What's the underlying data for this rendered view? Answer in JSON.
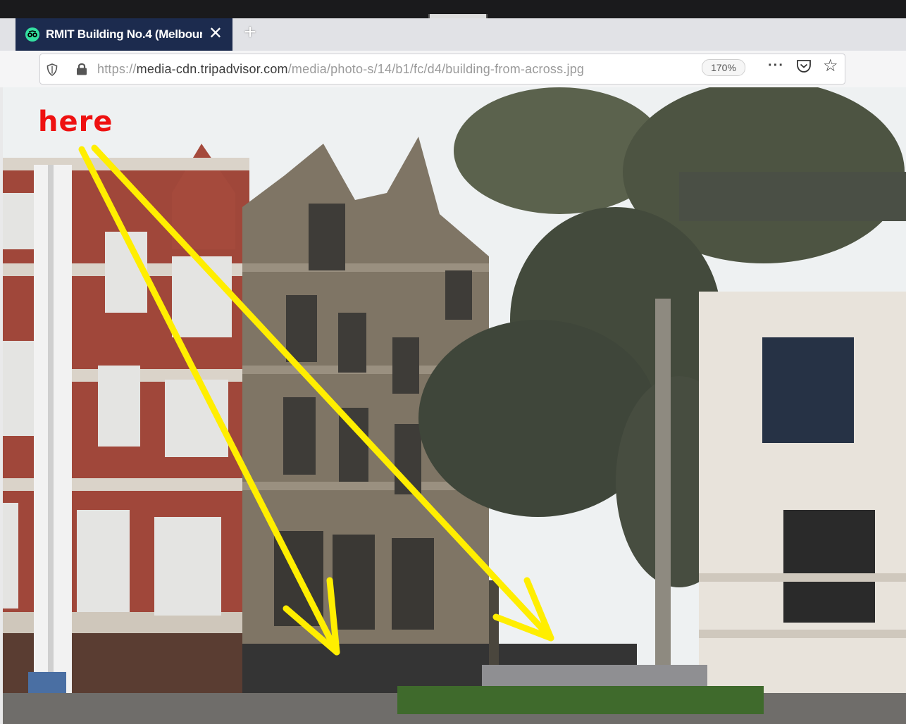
{
  "browser": {
    "tab": {
      "title": "RMIT Building No.4 (Melbourn",
      "favicon": "tripadvisor-owl-icon",
      "close_glyph": "✕"
    },
    "new_tab_glyph": "+",
    "url_scheme": "https://",
    "url_host": "media-cdn.tripadvisor.com",
    "url_path": "/media/photo-s/14/b1/fc/d4/building-from-across.jpg",
    "zoom": "170%",
    "more_glyph": "···",
    "bookmark_glyph": "☆",
    "icons": [
      "shield-icon",
      "lock-icon",
      "pocket-icon",
      "star-icon"
    ]
  },
  "annotation": {
    "label": "here",
    "label_color": "#ee1111",
    "arrow_color": "#ffee00"
  },
  "colors": {
    "tab_bg": "#1c2b4e",
    "favicon": "#34e0a1"
  }
}
